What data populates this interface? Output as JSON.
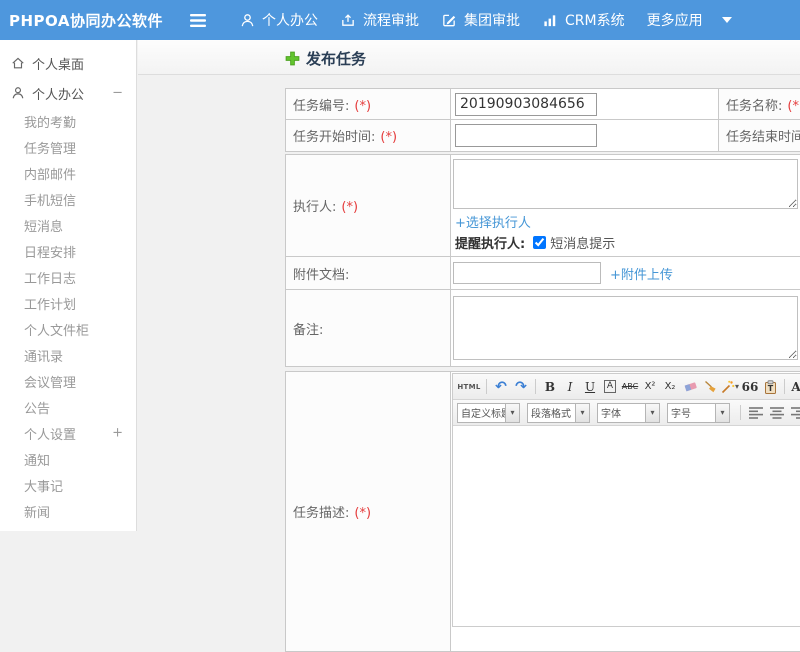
{
  "colors": {
    "topbar_blue": "#4e97dd",
    "link_blue": "#4596d6",
    "required_red": "#e53c3c",
    "plus_green": "#5fc22d",
    "page_title_text": "#2b3f56"
  },
  "topbar": {
    "logo": "PHPOA协同办公软件",
    "nav": [
      {
        "label": "个人办公"
      },
      {
        "label": "流程审批"
      },
      {
        "label": "集团审批"
      },
      {
        "label": "CRM系统"
      },
      {
        "label": "更多应用"
      }
    ]
  },
  "sidebar": {
    "items": [
      {
        "label": "个人桌面"
      },
      {
        "label": "个人办公",
        "toggle": "−"
      },
      {
        "label": "我的考勤"
      },
      {
        "label": "任务管理"
      },
      {
        "label": "内部邮件"
      },
      {
        "label": "手机短信"
      },
      {
        "label": "短消息"
      },
      {
        "label": "日程安排"
      },
      {
        "label": "工作日志"
      },
      {
        "label": "工作计划"
      },
      {
        "label": "个人文件柜"
      },
      {
        "label": "通讯录"
      },
      {
        "label": "会议管理"
      },
      {
        "label": "公告"
      },
      {
        "label": "个人设置",
        "toggle": "+"
      },
      {
        "label": "通知"
      },
      {
        "label": "大事记"
      },
      {
        "label": "新闻"
      }
    ]
  },
  "main": {
    "page_title": "发布任务",
    "form": {
      "required_mark": "(*)",
      "task_number_label": "任务编号:",
      "task_number_value": "20190903084656",
      "task_name_label": "任务名称:",
      "task_start_label": "任务开始时间:",
      "task_end_label": "任务结束时间:",
      "executor_label": "执行人:",
      "choose_executor_link": "+选择执行人",
      "remind_executor_label": "提醒执行人:",
      "sms_prompt_label": "短消息提示",
      "attachment_label": "附件文档:",
      "attachment_upload_link": "+附件上传",
      "remark_label": "备注:",
      "task_description_label": "任务描述:"
    },
    "editor": {
      "html_button": "HTML",
      "undo_glyph": "↶",
      "redo_glyph": "↷",
      "bold": "B",
      "italic": "I",
      "underline": "U",
      "font_box": "A",
      "strike": "ABC",
      "sup": "X²",
      "sub": "X₂",
      "quote": "66",
      "paste_letter": "T",
      "font_color": "A",
      "caret": "▾",
      "style_select": "自定义标题",
      "format_select": "段落格式",
      "font_select": "字体",
      "size_select": "字号"
    }
  }
}
